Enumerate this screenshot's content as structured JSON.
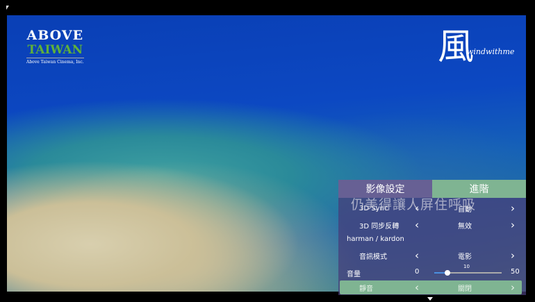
{
  "video": {
    "logo_left": {
      "line1": "ABOVE",
      "line2": "TAIWAN",
      "tagline": "Above Taiwan Cinema, Inc."
    },
    "logo_right": {
      "glyph": "風",
      "text": "windwithme"
    },
    "subtitle": "仍美得讓人屏住呼吸"
  },
  "panel": {
    "tabs": [
      {
        "label": "影像設定",
        "active": false
      },
      {
        "label": "進階",
        "active": true
      }
    ],
    "rows": [
      {
        "label": "3D Sync",
        "value": "自動"
      },
      {
        "label": "3D 同步反轉",
        "value": "無效"
      }
    ],
    "section": "harman / kardon",
    "audio_mode": {
      "label": "音訊模式",
      "value": "電影"
    },
    "volume": {
      "label": "音量",
      "min": "0",
      "max": "50",
      "value": "10",
      "value_num": 10
    },
    "mute": {
      "label": "靜音",
      "value": "關閉"
    },
    "left_arrow": "‹",
    "right_arrow": "›"
  },
  "colors": {
    "accent": "#7fb492",
    "slider": "#4a90e0"
  }
}
